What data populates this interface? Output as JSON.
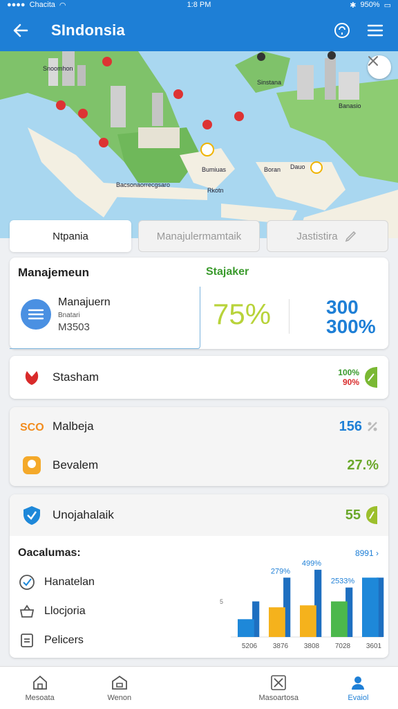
{
  "status": {
    "carrier": "Chacita",
    "time": "1:8 PM",
    "battery": "950%"
  },
  "appbar": {
    "title": "SIndonsia",
    "back_icon": "arrow-left-icon",
    "help_icon": "headset-icon",
    "menu_icon": "menu-icon"
  },
  "map": {
    "labels": [
      "Sinstana",
      "Banasio",
      "Snoomhon",
      "Bacsonaorrecgsaro",
      "Bumiuas",
      "Boran",
      "Dauo",
      "Rkotn"
    ]
  },
  "tabs": [
    {
      "label": "Ntpania",
      "active": true
    },
    {
      "label": "Manajulermamtaik",
      "active": false
    },
    {
      "label": "Jastistira",
      "active": false
    }
  ],
  "stats": {
    "left_title": "Manajemeun",
    "right_title": "Stajaker",
    "item_title": "Manajuern",
    "item_sub": "Bnatari",
    "item_code": "M3503",
    "value_pct": "75%",
    "value_blue_1": "300",
    "value_blue_2": "300%"
  },
  "rows": {
    "r1": {
      "label": "Stasham",
      "value_top": "100%",
      "value_bottom": "90%"
    },
    "r2": {
      "label": "Malbeja",
      "value": "156"
    },
    "r3": {
      "label": "Bevalem",
      "value": "27.%"
    },
    "r4": {
      "label": "Unojahalaik",
      "value": "55"
    }
  },
  "chart_section": {
    "title": "Oacalumas:",
    "link": "8991",
    "legend": [
      "Hanatelan",
      "Llocjoria",
      "Pelicers"
    ]
  },
  "chart_data": {
    "type": "bar",
    "categories": [
      "5206",
      "3876",
      "3808",
      "7028",
      "3601"
    ],
    "series": [
      {
        "values": [
          18,
          30,
          32,
          36,
          60
        ]
      },
      {
        "values": [
          36,
          60,
          68,
          50,
          60
        ]
      }
    ],
    "data_labels": [
      "279%",
      "499%",
      "2533%"
    ],
    "colors": [
      "#1e88d9",
      "#f5b21c",
      "#f5b21c",
      "#4cb84c",
      "#1e88d9"
    ]
  },
  "bottomnav": [
    {
      "label": "Mesoata",
      "icon": "home-icon",
      "active": false
    },
    {
      "label": "Wenon",
      "icon": "house-icon",
      "active": false
    },
    {
      "label": "Masoartosa",
      "icon": "tools-icon",
      "active": false
    },
    {
      "label": "Evaiol",
      "icon": "person-icon",
      "active": true
    }
  ]
}
